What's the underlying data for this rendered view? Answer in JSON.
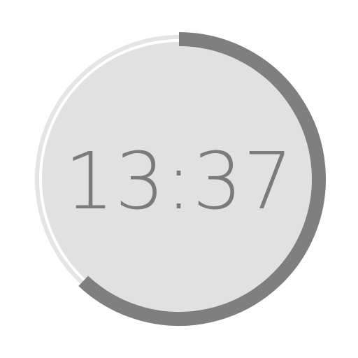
{
  "clock": {
    "time": "13:37",
    "progress_fraction": 0.62
  },
  "colors": {
    "background": "#ffffff",
    "face": "#e1e1e1",
    "track": "#e4e4e4",
    "progress": "#7f7f7f",
    "text": "#7b7b7b"
  }
}
